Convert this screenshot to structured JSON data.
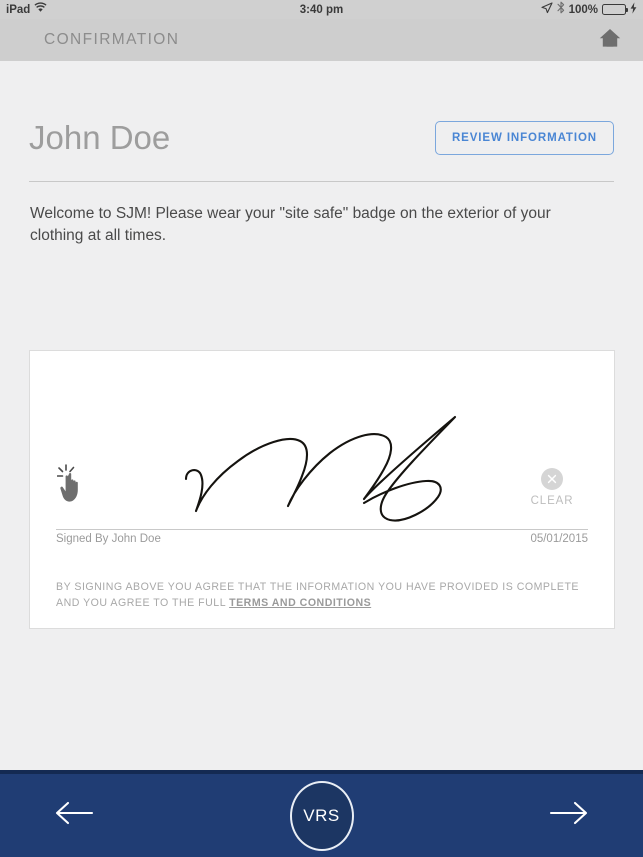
{
  "statusbar": {
    "device": "iPad",
    "wifi_icon": "wifi-icon",
    "time": "3:40 pm",
    "location_icon": "location-arrow-icon",
    "bluetooth_icon": "bluetooth-icon",
    "battery_percent": "100%",
    "battery_level": 100,
    "battery_color": "#4cd964",
    "charging_icon": "lightning-bolt-icon"
  },
  "navbar": {
    "title": "CONFIRMATION",
    "home_icon": "home-icon"
  },
  "main": {
    "person_name": "John Doe",
    "review_button_label": "REVIEW INFORMATION",
    "welcome_message": "Welcome to SJM! Please wear your \"site safe\" badge on the exterior of your clothing at all times.",
    "signature": {
      "tap_icon": "tap-hand-icon",
      "clear_icon": "close-circle-icon",
      "clear_label": "CLEAR",
      "signed_by": "Signed By John Doe",
      "date": "05/01/2015",
      "terms_text_part1": "BY SIGNING ABOVE YOU AGREE THAT THE INFORMATION YOU HAVE PROVIDED IS COMPLETE AND YOU AGREE TO THE FULL ",
      "terms_link_label": "TERMS AND CONDITIONS"
    }
  },
  "footer": {
    "back_icon": "arrow-left-icon",
    "forward_icon": "arrow-right-icon",
    "badge_label": "VRS",
    "background_color": "#203d74",
    "badge_fill_color": "#1c3663"
  }
}
